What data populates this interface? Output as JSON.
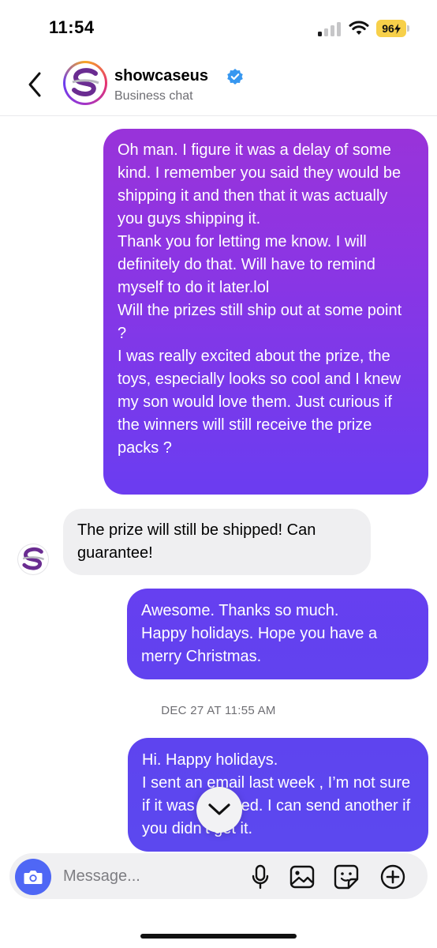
{
  "status_bar": {
    "time": "11:54",
    "battery": "96"
  },
  "header": {
    "name": "showcaseus",
    "subtitle": "Business chat"
  },
  "messages": [
    {
      "direction": "outgoing",
      "text": "Oh man. I figure it was a delay of some kind. I remember you said they would be shipping it and then that it was actually you guys shipping it.\nThank you for letting me know.  I will definitely do that. Will have to remind myself to do it later.lol\nWill the prizes still ship out at some point ?\nI was really excited about the prize, the toys, especially looks so cool and I knew my son would love them. Just curious if the winners will still receive the prize packs ?"
    },
    {
      "direction": "incoming",
      "text": "The prize will still be shipped! Can guarantee!"
    },
    {
      "direction": "outgoing",
      "text": "Awesome. Thanks so much.\nHappy holidays. Hope you have a merry Christmas."
    },
    {
      "direction": "outgoing",
      "text": "Hi. Happy holidays.\nI sent an email last week , I’m not sure if it was received. I can send another if you didn’t get it."
    }
  ],
  "timestamp": "DEC 27 AT 11:55 AM",
  "composer": {
    "placeholder": "Message..."
  },
  "colors": {
    "outgoing_gradient_top": "#a531cf",
    "outgoing_gradient_bottom": "#5b49ef",
    "incoming_bubble": "#efeff1",
    "camera_button": "#4f67f5",
    "verified_badge": "#3797f0",
    "brand_purple": "#6a2c91",
    "battery": "#f7d04a"
  },
  "icons": [
    "back-chevron-icon",
    "verified-badge-icon",
    "scroll-down-chevron-icon",
    "camera-icon",
    "microphone-icon",
    "gallery-icon",
    "sticker-icon",
    "add-icon"
  ]
}
